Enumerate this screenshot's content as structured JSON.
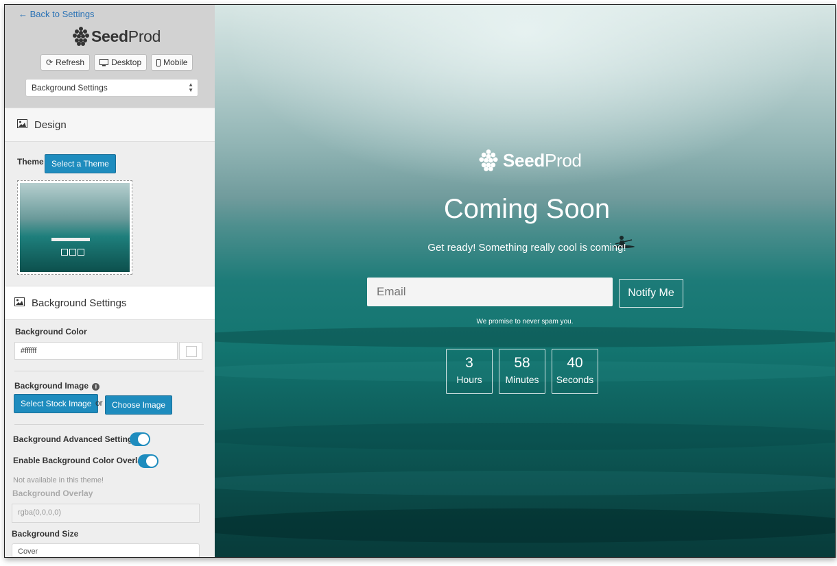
{
  "sidebar": {
    "back_link": "← Back to Settings",
    "logo_text_bold": "Seed",
    "logo_text_light": "Prod",
    "buttons": {
      "refresh": "Refresh",
      "desktop": "Desktop",
      "mobile": "Mobile"
    },
    "section_select": "Background Settings",
    "design_heading": "Design",
    "theme_label": "Theme",
    "select_theme_button": "Select a Theme",
    "background_heading": "Background Settings",
    "background_color_label": "Background Color",
    "background_color_value": "#ffffff",
    "background_image_label": "Background Image",
    "select_stock_image_button": "Select Stock Image",
    "or_text": "or",
    "choose_image_button": "Choose Image",
    "advanced_settings_label": "Background Advanced Settings",
    "advanced_settings_on": true,
    "color_overlay_label": "Enable Background Color Overlay",
    "color_overlay_on": true,
    "not_available_note": "Not available in this theme!",
    "overlay_label": "Background Overlay",
    "overlay_value": "rgba(0,0,0,0)",
    "size_label": "Background Size",
    "size_value": "Cover"
  },
  "preview": {
    "logo_text_bold": "Seed",
    "logo_text_light": "Prod",
    "title": "Coming Soon",
    "subtitle": "Get ready! Something really cool is coming!",
    "email_placeholder": "Email",
    "notify_button": "Notify Me",
    "promise": "We promise to never spam you.",
    "countdown": [
      {
        "value": "3",
        "unit": "Hours"
      },
      {
        "value": "58",
        "unit": "Minutes"
      },
      {
        "value": "40",
        "unit": "Seconds"
      }
    ]
  },
  "colors": {
    "accent_blue": "#1e8cbe",
    "link_blue": "#2a72b5",
    "sea_teal": "#137570"
  }
}
